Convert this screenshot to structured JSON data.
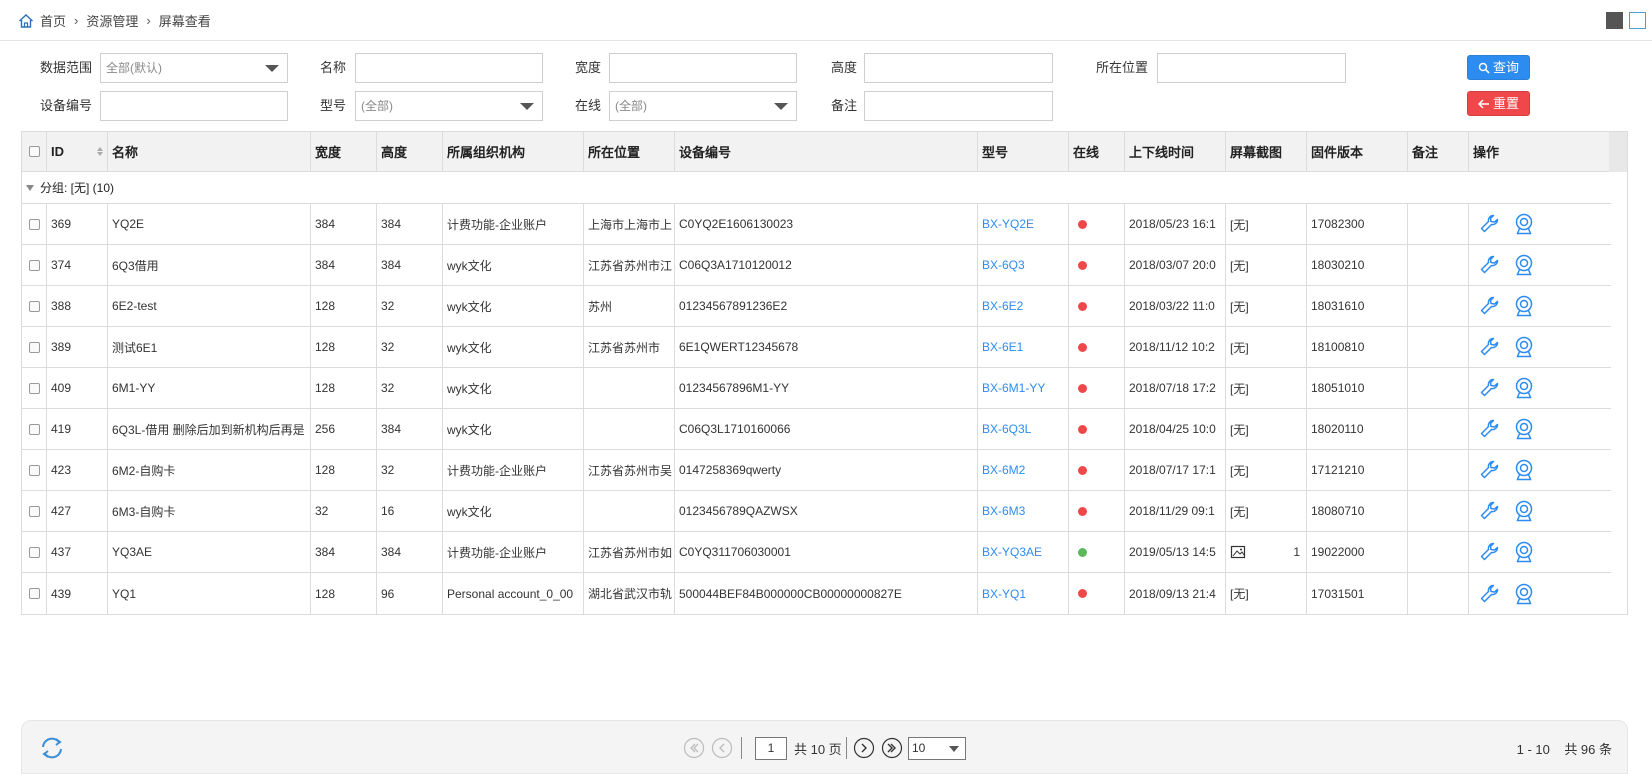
{
  "breadcrumb": [
    "首页",
    "资源管理",
    "屏幕查看"
  ],
  "filters": {
    "scope_label": "数据范围",
    "scope_value": "全部(默认)",
    "name_label": "名称",
    "width_label": "宽度",
    "height_label": "高度",
    "location_label": "所在位置",
    "device_no_label": "设备编号",
    "model_label": "型号",
    "model_value": "(全部)",
    "online_label": "在线",
    "online_value": "(全部)",
    "note_label": "备注"
  },
  "buttons": {
    "query": "查询",
    "reset": "重置"
  },
  "columns": [
    "ID",
    "名称",
    "宽度",
    "高度",
    "所属组织机构",
    "所在位置",
    "设备编号",
    "型号",
    "在线",
    "上下线时间",
    "屏幕截图",
    "固件版本",
    "备注",
    "操作"
  ],
  "group_label": "分组: [无] (10)",
  "colors": {
    "link": "#2d8cf0",
    "offline": "#f0484a",
    "online": "#5cb85c",
    "query_btn": "#2d8cf0",
    "reset_btn": "#f0484a"
  },
  "rows": [
    {
      "id": "369",
      "name": "YQ2E",
      "width": "384",
      "height": "384",
      "org": "计费功能-企业账户",
      "location": "上海市上海市上",
      "device_no": "C0YQ2E1606130023",
      "model": "BX-YQ2E",
      "online": "offline",
      "time": "2018/05/23 16:1",
      "screenshot": "[无]",
      "shot_count": "",
      "firmware": "17082300",
      "note": ""
    },
    {
      "id": "374",
      "name": "6Q3借用",
      "width": "384",
      "height": "384",
      "org": "wyk文化",
      "location": "江苏省苏州市江",
      "device_no": "C06Q3A1710120012",
      "model": "BX-6Q3",
      "online": "offline",
      "time": "2018/03/07 20:0",
      "screenshot": "[无]",
      "shot_count": "",
      "firmware": "18030210",
      "note": ""
    },
    {
      "id": "388",
      "name": "6E2-test",
      "width": "128",
      "height": "32",
      "org": "wyk文化",
      "location": "苏州",
      "device_no": "01234567891236E2",
      "model": "BX-6E2",
      "online": "offline",
      "time": "2018/03/22 11:0",
      "screenshot": "[无]",
      "shot_count": "",
      "firmware": "18031610",
      "note": ""
    },
    {
      "id": "389",
      "name": "测试6E1",
      "width": "128",
      "height": "32",
      "org": "wyk文化",
      "location": "江苏省苏州市",
      "device_no": "6E1QWERT12345678",
      "model": "BX-6E1",
      "online": "offline",
      "time": "2018/11/12 10:2",
      "screenshot": "[无]",
      "shot_count": "",
      "firmware": "18100810",
      "note": ""
    },
    {
      "id": "409",
      "name": "6M1-YY",
      "width": "128",
      "height": "32",
      "org": "wyk文化",
      "location": "",
      "device_no": "01234567896M1-YY",
      "model": "BX-6M1-YY",
      "online": "offline",
      "time": "2018/07/18 17:2",
      "screenshot": "[无]",
      "shot_count": "",
      "firmware": "18051010",
      "note": ""
    },
    {
      "id": "419",
      "name": "6Q3L-借用 删除后加到新机构后再是",
      "width": "256",
      "height": "384",
      "org": "wyk文化",
      "location": "",
      "device_no": "C06Q3L1710160066",
      "model": "BX-6Q3L",
      "online": "offline",
      "time": "2018/04/25 10:0",
      "screenshot": "[无]",
      "shot_count": "",
      "firmware": "18020110",
      "note": ""
    },
    {
      "id": "423",
      "name": "6M2-自购卡",
      "width": "128",
      "height": "32",
      "org": "计费功能-企业账户",
      "location": "江苏省苏州市吴",
      "device_no": "0147258369qwerty",
      "model": "BX-6M2",
      "online": "offline",
      "time": "2018/07/17 17:1",
      "screenshot": "[无]",
      "shot_count": "",
      "firmware": "17121210",
      "note": ""
    },
    {
      "id": "427",
      "name": "6M3-自购卡",
      "width": "32",
      "height": "16",
      "org": "wyk文化",
      "location": "",
      "device_no": "0123456789QAZWSX",
      "model": "BX-6M3",
      "online": "offline",
      "time": "2018/11/29 09:1",
      "screenshot": "[无]",
      "shot_count": "",
      "firmware": "18080710",
      "note": ""
    },
    {
      "id": "437",
      "name": "YQ3AE",
      "width": "384",
      "height": "384",
      "org": "计费功能-企业账户",
      "location": "江苏省苏州市如",
      "device_no": "C0YQ311706030001",
      "model": "BX-YQ3AE",
      "online": "online",
      "time": "2019/05/13 14:5",
      "screenshot": "",
      "shot_count": "1",
      "firmware": "19022000",
      "note": ""
    },
    {
      "id": "439",
      "name": "YQ1",
      "width": "128",
      "height": "96",
      "org": "Personal account_0_00",
      "location": "湖北省武汉市轨",
      "device_no": "500044BEF84B000000CB00000000827E",
      "model": "BX-YQ1",
      "online": "offline",
      "time": "2018/09/13 21:4",
      "screenshot": "[无]",
      "shot_count": "",
      "firmware": "17031501",
      "note": ""
    }
  ],
  "pager": {
    "current_page": "1",
    "total_pages_text": "共 10 页",
    "page_size": "10",
    "range_text": "1 - 10",
    "total_text": "共 96 条"
  }
}
